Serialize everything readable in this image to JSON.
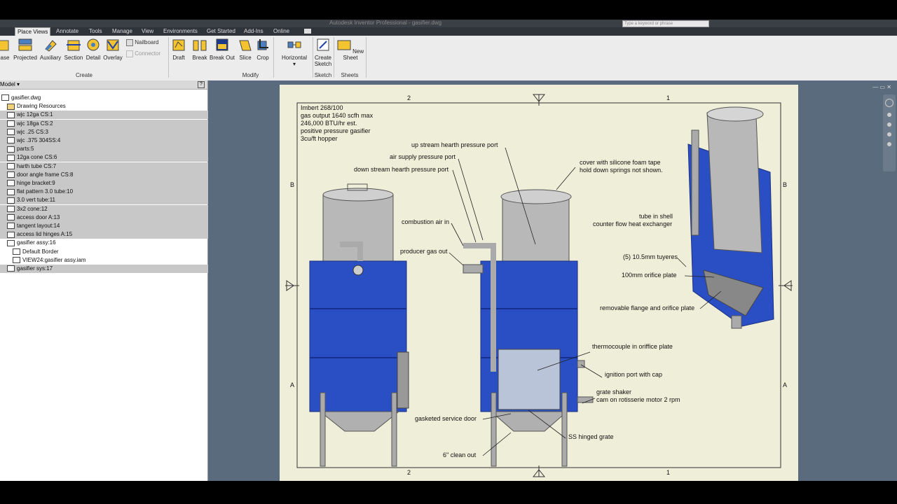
{
  "window": {
    "title": "Autodesk Inventor Professional - gasifier.dwg",
    "search_placeholder": "Type a keyword or phrase"
  },
  "menu": {
    "tabs": [
      "Place Views",
      "Annotate",
      "Tools",
      "Manage",
      "View",
      "Environments",
      "Get Started",
      "Add-Ins",
      "Online"
    ],
    "active": "Place Views"
  },
  "ribbon": {
    "create": [
      "ase",
      "Projected",
      "Auxiliary",
      "Section",
      "Detail",
      "Overlay"
    ],
    "nailboard": "Nailboard",
    "connector": "Connector",
    "modify": [
      "Draft",
      "Break",
      "Break Out",
      "Slice",
      "Crop"
    ],
    "horizontal": "Horizontal",
    "sketch_btn": [
      "Create",
      "Sketch"
    ],
    "sheet_btn": "New Sheet",
    "groups": {
      "create": "Create",
      "modify": "Modify",
      "sketch": "Sketch",
      "sheets": "Sheets"
    }
  },
  "browser": {
    "header": "Model ▾",
    "items": [
      {
        "label": "gasifier.dwg",
        "selected": false,
        "indent": 0
      },
      {
        "label": "Drawing Resources",
        "selected": false,
        "indent": 1
      },
      {
        "label": "wjc 12ga CS:1",
        "selected": true,
        "indent": 1
      },
      {
        "label": "wjc 18ga CS:2",
        "selected": true,
        "indent": 1
      },
      {
        "label": "wjc .25 CS:3",
        "selected": true,
        "indent": 1
      },
      {
        "label": "wjc .375 304SS:4",
        "selected": true,
        "indent": 1
      },
      {
        "label": "parts:5",
        "selected": true,
        "indent": 1
      },
      {
        "label": "12ga cone CS:6",
        "selected": true,
        "indent": 1
      },
      {
        "label": "harth tube CS:7",
        "selected": true,
        "indent": 1
      },
      {
        "label": "door angle frame CS:8",
        "selected": true,
        "indent": 1
      },
      {
        "label": "hinge bracket:9",
        "selected": true,
        "indent": 1
      },
      {
        "label": "flat pattern 3.0 tube:10",
        "selected": true,
        "indent": 1
      },
      {
        "label": "3.0 vert tube:11",
        "selected": true,
        "indent": 1
      },
      {
        "label": "3x2 cone:12",
        "selected": true,
        "indent": 1
      },
      {
        "label": "access door A:13",
        "selected": true,
        "indent": 1
      },
      {
        "label": "tangent layout:14",
        "selected": true,
        "indent": 1
      },
      {
        "label": "access lid hinges A:15",
        "selected": true,
        "indent": 1
      },
      {
        "label": "gasifier assy:16",
        "selected": false,
        "indent": 1
      },
      {
        "label": "Default Border",
        "selected": false,
        "indent": 2
      },
      {
        "label": "VIEW24:gasifier assy.iam",
        "selected": false,
        "indent": 2
      },
      {
        "label": "gasifier sys:17",
        "selected": true,
        "indent": 1
      }
    ]
  },
  "drawing": {
    "notes": [
      "Imbert 268/100",
      "gas output 1640 scfh max",
      "246,000 BTU/hr est.",
      "positive pressure gasifier",
      "3cu/ft hopper"
    ],
    "zones_top": [
      "2",
      "1"
    ],
    "zones_side": [
      "B",
      "A"
    ],
    "callouts": {
      "upstream": "up stream hearth pressure port",
      "airsupply": "air supply pressure port",
      "downstream": "down stream hearth pressure port",
      "cover": "cover with silicone foam tape",
      "cover2": "hold down springs not shown.",
      "combustion": "combustion air in",
      "producer": "producer gas out",
      "tube": "tube in shell",
      "tube2": "counter flow heat exchanger",
      "tuyeres": "(5) 10.5mm tuyeres",
      "orifice": "100mm orifice plate",
      "flange": "removable flange and orifice plate",
      "thermo": "thermocouple in oriffice plate",
      "ignition": "ignition port with cap",
      "grate": "grate shaker",
      "grate2": "cam on rotisserie motor 2 rpm",
      "service": "gasketed service door",
      "hinged": "SS hinged grate",
      "cleanout": "6\" clean out"
    }
  },
  "colors": {
    "vessel_blue": "#2a4fc4",
    "steel": "#b9b9b9",
    "sheet": "#efeed8",
    "canvas": "#5a6b7d"
  }
}
